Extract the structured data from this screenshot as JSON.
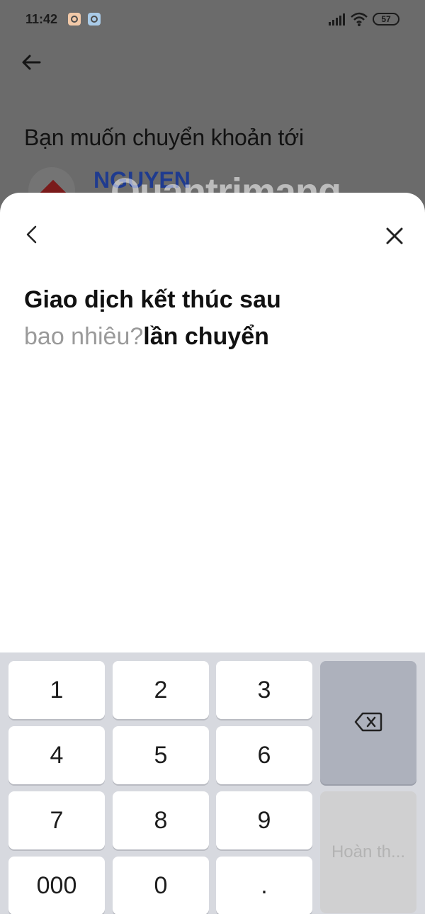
{
  "status_bar": {
    "time": "11:42",
    "battery": "57"
  },
  "background": {
    "title": "Bạn muốn chuyển khoản tới",
    "recipient_name": "NGUYEN",
    "watermark": "Quantrimang"
  },
  "sheet": {
    "heading": "Giao dịch kết thúc sau",
    "input_placeholder": "bao nhiêu?",
    "unit": "lần chuyển"
  },
  "keypad": {
    "keys": [
      "1",
      "2",
      "3",
      "4",
      "5",
      "6",
      "7",
      "8",
      "9",
      "000",
      "0",
      "."
    ],
    "done_label": "Hoàn th..."
  }
}
